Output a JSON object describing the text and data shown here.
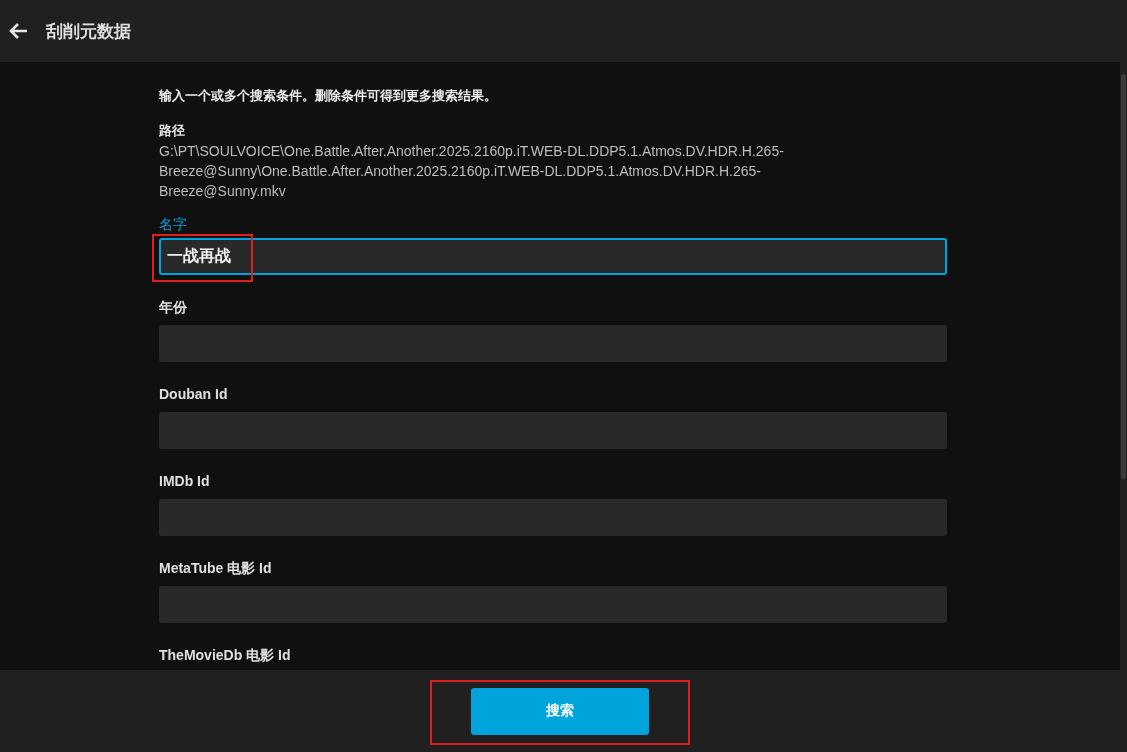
{
  "header": {
    "title": "刮削元数据"
  },
  "intro": "输入一个或多个搜索条件。删除条件可得到更多搜索结果。",
  "path": {
    "label": "路径",
    "value": "G:\\PT\\SOULVOICE\\One.Battle.After.Another.2025.2160p.iT.WEB-DL.DDP5.1.Atmos.DV.HDR.H.265-Breeze@Sunny\\One.Battle.After.Another.2025.2160p.iT.WEB-DL.DDP5.1.Atmos.DV.HDR.H.265-Breeze@Sunny.mkv"
  },
  "fields": [
    {
      "label": "名字",
      "value": "一战再战",
      "focused": true
    },
    {
      "label": "年份",
      "focused": false
    },
    {
      "label": "Douban Id",
      "focused": false
    },
    {
      "label": "IMDb Id",
      "focused": false
    },
    {
      "label": "MetaTube 电影 Id",
      "focused": false
    },
    {
      "label": "TheMovieDb 电影 Id",
      "focused": false
    }
  ],
  "footer": {
    "button": "搜索"
  }
}
